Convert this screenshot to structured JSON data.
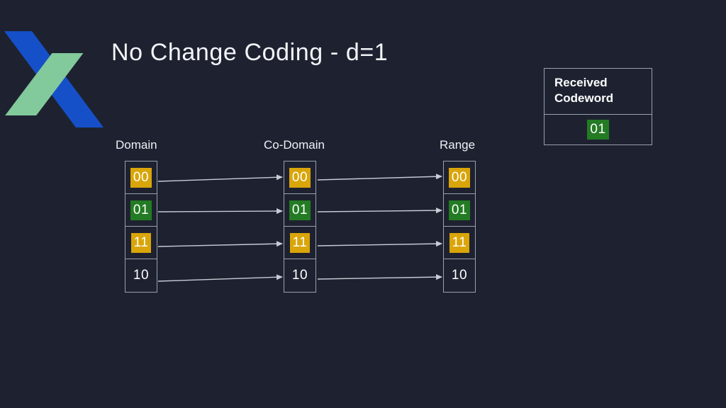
{
  "slide": {
    "title": "No Change Coding - d=1"
  },
  "logo": {
    "name": "brand-logo",
    "blue": "#1550c8",
    "green": "#82c99b"
  },
  "received_codeword": {
    "header": "Received\nCodeword",
    "header_line1": "Received",
    "header_line2": "Codeword",
    "value": "01",
    "value_highlight": "green"
  },
  "colors": {
    "background": "#1e2230",
    "border": "#9aa0ad",
    "text": "#f2f4f8",
    "gold": "#d9a509",
    "green": "#237b23",
    "arrow": "#c8ccd6"
  },
  "diagram": {
    "columns": [
      {
        "label": "Domain",
        "cells": [
          {
            "value": "00",
            "highlight": "gold"
          },
          {
            "value": "01",
            "highlight": "green"
          },
          {
            "value": "11",
            "highlight": "gold"
          },
          {
            "value": "10",
            "highlight": "none"
          }
        ]
      },
      {
        "label": "Co-Domain",
        "cells": [
          {
            "value": "00",
            "highlight": "gold"
          },
          {
            "value": "01",
            "highlight": "green"
          },
          {
            "value": "11",
            "highlight": "gold"
          },
          {
            "value": "10",
            "highlight": "none"
          }
        ]
      },
      {
        "label": "Range",
        "cells": [
          {
            "value": "00",
            "highlight": "gold"
          },
          {
            "value": "01",
            "highlight": "green"
          },
          {
            "value": "11",
            "highlight": "gold"
          },
          {
            "value": "10",
            "highlight": "none"
          }
        ]
      }
    ],
    "mappings": [
      {
        "from": "00",
        "to": "00"
      },
      {
        "from": "01",
        "to": "01"
      },
      {
        "from": "11",
        "to": "11"
      },
      {
        "from": "10",
        "to": "10"
      }
    ]
  }
}
